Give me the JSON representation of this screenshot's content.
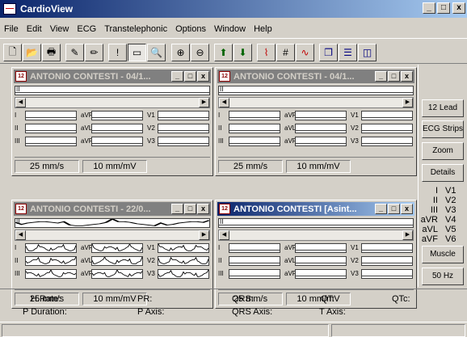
{
  "app": {
    "title": "CardioView",
    "controls": {
      "minimize": "_",
      "maximize": "□",
      "close": "x"
    }
  },
  "menu": [
    "File",
    "Edit",
    "View",
    "ECG",
    "Transtelephonic",
    "Options",
    "Window",
    "Help"
  ],
  "toolbar": [
    {
      "name": "new-icon",
      "glyph": "🗋"
    },
    {
      "name": "open-icon",
      "glyph": "📂"
    },
    {
      "name": "print-icon",
      "glyph": "🖶"
    },
    {
      "name": "tool-icon",
      "glyph": "✎"
    },
    {
      "name": "edit-icon",
      "glyph": "✏"
    },
    {
      "name": "marker-icon",
      "glyph": "!"
    },
    {
      "name": "ruler-icon",
      "glyph": "▭"
    },
    {
      "name": "magnifier-icon",
      "glyph": "🔍"
    },
    {
      "name": "zoom-in-icon",
      "glyph": "⊕"
    },
    {
      "name": "zoom-out-icon",
      "glyph": "⊖"
    },
    {
      "name": "arrow-up-icon",
      "glyph": "⬆"
    },
    {
      "name": "arrow-down-icon",
      "glyph": "⬇"
    },
    {
      "name": "ecg-wave-icon",
      "glyph": "⌇"
    },
    {
      "name": "grid-icon",
      "glyph": "#"
    },
    {
      "name": "wave-icon",
      "glyph": "∿"
    },
    {
      "name": "cascade-icon",
      "glyph": "❐"
    },
    {
      "name": "tile-horizontal-icon",
      "glyph": "☰"
    },
    {
      "name": "tile-vertical-icon",
      "glyph": "◫"
    }
  ],
  "windows": [
    {
      "title": "ANTONIO CONTESTI - 04/1...",
      "active": false,
      "trace": "flat",
      "speed": "25 mm/s",
      "gain": "10 mm/mV"
    },
    {
      "title": "ANTONIO CONTESTI - 04/1...",
      "active": false,
      "trace": "flat",
      "speed": "25 mm/s",
      "gain": "10 mm/mV"
    },
    {
      "title": "ANTONIO CONTESTI - 22/0...",
      "active": false,
      "trace": "wave",
      "speed": "25 mm/s",
      "gain": "10 mm/mV"
    },
    {
      "title": "ANTONIO CONTESTI [Asint...",
      "active": true,
      "trace": "flat",
      "speed": "25 mm/s",
      "gain": "10 mm/mV"
    }
  ],
  "leads": [
    "I",
    "II",
    "III",
    "aVR",
    "aVL",
    "aVF",
    "V1",
    "V2",
    "V3",
    "V4",
    "V5",
    "V6"
  ],
  "side": {
    "buttons": [
      "12 Lead",
      "ECG Strips",
      "Zoom",
      "Details"
    ],
    "lead_columns": [
      [
        "I",
        "II",
        "III",
        "aVR",
        "aVL",
        "aVF"
      ],
      [
        "V1",
        "V2",
        "V3",
        "V4",
        "V5",
        "V6"
      ]
    ],
    "filter_buttons": [
      "Muscle",
      "50 Hz"
    ]
  },
  "measurements": {
    "row1": [
      "H.Rate:",
      "PR:",
      "QRS:",
      "QT:",
      "QTc:"
    ],
    "row2": [
      "P Duration:",
      "P Axis:",
      "QRS Axis:",
      "T Axis:"
    ]
  }
}
